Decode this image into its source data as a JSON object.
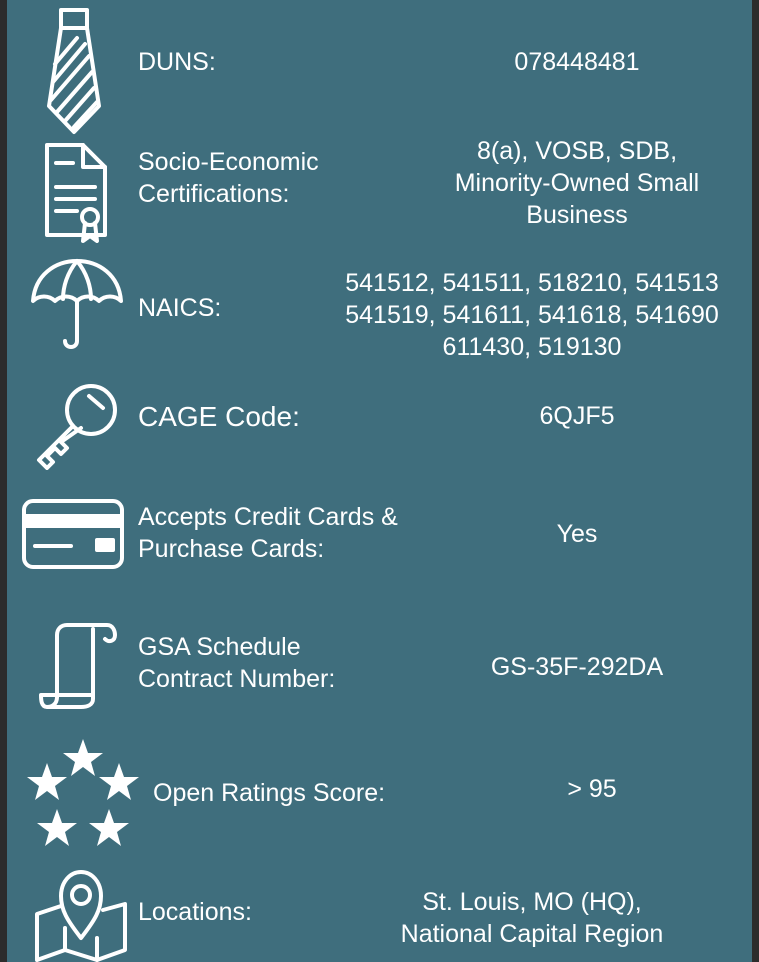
{
  "colors": {
    "background": "#3f6e7d",
    "border": "#2c2c2c",
    "text": "#ffffff"
  },
  "rows": [
    {
      "icon": "tie-icon",
      "label": [
        "DUNS:"
      ],
      "value": [
        "078448481"
      ]
    },
    {
      "icon": "certificate-document-icon",
      "label": [
        "Socio-Economic",
        "Certifications:"
      ],
      "value": [
        "8(a), VOSB, SDB,",
        "Minority-Owned Small",
        "Business"
      ]
    },
    {
      "icon": "umbrella-icon",
      "label": [
        "NAICS:"
      ],
      "value": [
        "541512, 541511, 518210, 541513",
        "541519, 541611, 541618, 541690",
        "611430, 519130"
      ]
    },
    {
      "icon": "key-icon",
      "label": [
        "CAGE Code:"
      ],
      "value": [
        "6QJF5"
      ]
    },
    {
      "icon": "credit-card-icon",
      "label": [
        "Accepts Credit Cards &",
        "Purchase Cards:"
      ],
      "value": [
        "Yes"
      ]
    },
    {
      "icon": "scroll-icon",
      "label": [
        "GSA Schedule",
        "Contract Number:"
      ],
      "value": [
        "GS-35F-292DA"
      ]
    },
    {
      "icon": "stars-icon",
      "label": [
        "Open Ratings Score:"
      ],
      "value": [
        "> 95"
      ]
    },
    {
      "icon": "map-pin-icon",
      "label": [
        "Locations:"
      ],
      "value": [
        "St. Louis, MO (HQ),",
        "National Capital Region"
      ]
    }
  ]
}
